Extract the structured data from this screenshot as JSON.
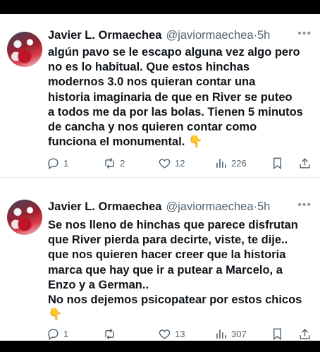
{
  "tweets": [
    {
      "author_name": "Javier L. Ormaechea",
      "handle": "@javiormaechea",
      "separator": "·",
      "time": "5h",
      "more_icon": "ellipsis-icon",
      "text": "algún pavo se le escapo alguna vez algo pero\nno es lo habitual. Que estos hinchas\nmodernos 3.0 nos quieran contar una\nhistoria imaginaria de que en River se puteo\na todos me da por las bolas. Tienen 5 minutos\nde cancha y nos quieren contar como\nfunciona el monumental.",
      "emoji": "👇",
      "replies": "1",
      "retweets": "2",
      "likes": "12",
      "views": "226"
    },
    {
      "author_name": "Javier L. Ormaechea",
      "handle": "@javiormaechea",
      "separator": "·",
      "time": "5h",
      "more_icon": "ellipsis-icon",
      "text": "Se nos lleno de hinchas que parece disfrutan\nque River pierda para decirte, viste, te dije..\nque nos quieren hacer creer que la historia\nmarca que hay que ir a putear a Marcelo, a\nEnzo y a German..\nNo nos dejemos psicopatear por estos chicos",
      "emoji": "👇",
      "replies": "1",
      "retweets": "",
      "likes": "13",
      "views": "307"
    }
  ],
  "colors": {
    "text_primary": "#0f1419",
    "text_secondary": "#536471",
    "background": "#ffffff",
    "frame": "#000000",
    "emoji": "#f7b500"
  }
}
